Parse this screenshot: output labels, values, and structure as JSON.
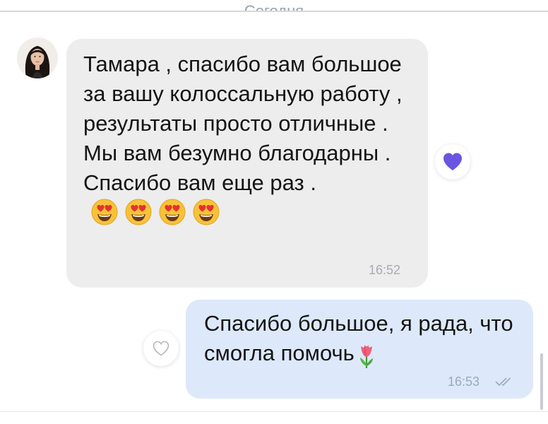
{
  "chat": {
    "date_separator": "Сегодня",
    "incoming": {
      "text": "Тамара , спасибо вам большое за вашу колоссальную работу , результаты просто отличные . Мы вам безумно благодарны . Спасибо вам еще раз .",
      "emojis": [
        "heart-eyes-emoji",
        "heart-eyes-emoji",
        "heart-eyes-emoji",
        "heart-eyes-emoji"
      ],
      "time": "16:52",
      "reaction": "purple-heart-icon"
    },
    "outgoing": {
      "text": "Спасибо большое, я рада, что смогла помочь",
      "emoji": "tulip-emoji",
      "time": "16:53",
      "status_icon": "double-check-icon"
    }
  },
  "colors": {
    "incoming_bubble": "#ededee",
    "outgoing_bubble": "#dde9fb",
    "reaction_heart": "#6a55e0"
  }
}
